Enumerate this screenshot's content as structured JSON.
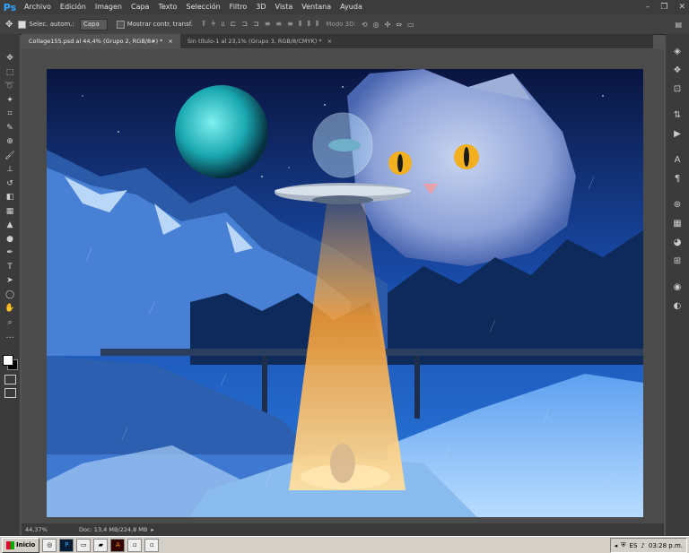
{
  "app": {
    "logo": "Ps"
  },
  "menu": [
    "Archivo",
    "Edición",
    "Imagen",
    "Capa",
    "Texto",
    "Selección",
    "Filtro",
    "3D",
    "Vista",
    "Ventana",
    "Ayuda"
  ],
  "options": {
    "auto_select_label": "Selec. autom.:",
    "auto_select_value": "Capa",
    "show_transform_label": "Mostrar contr. transf.",
    "mode_3d_label": "Modo 3D:"
  },
  "tabs": [
    {
      "label": "Collage155.psd al 44,4% (Grupo 2, RGB/8#) *",
      "close": "×"
    },
    {
      "label": "Sin título-1 al 23,1% (Grupo 3, RGB/8/CMYK) *",
      "close": "×"
    }
  ],
  "status": {
    "zoom": "44,37%",
    "doc": "Doc: 13,4 MB/224,8 MB"
  },
  "taskbar": {
    "start": "Inicio",
    "lang": "ES",
    "time": "03:28 p.m."
  }
}
